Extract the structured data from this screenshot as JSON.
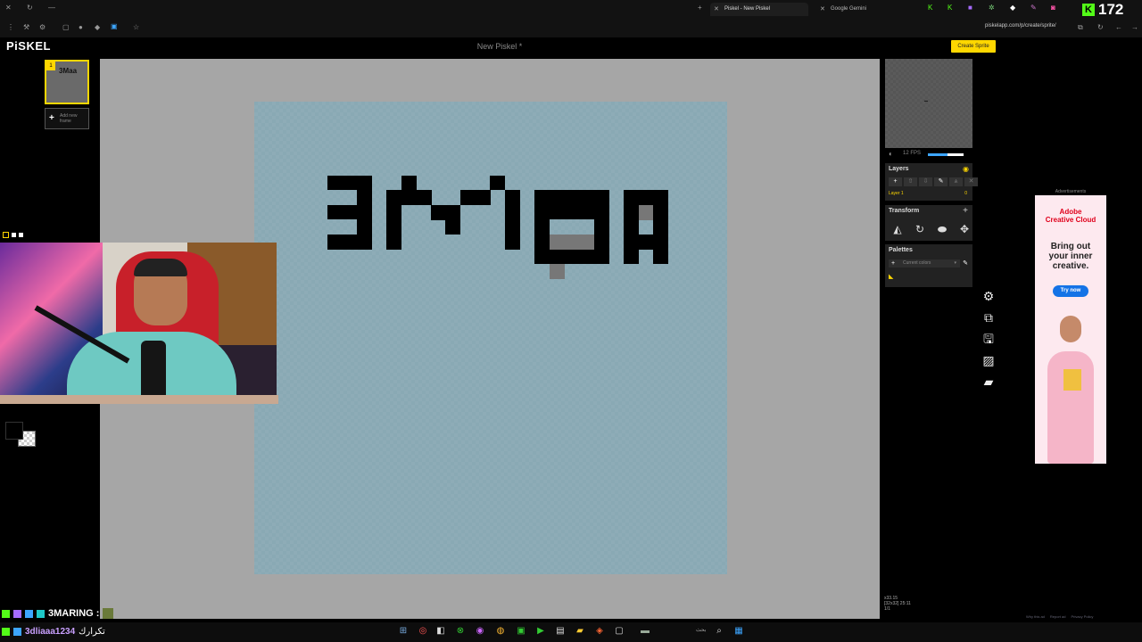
{
  "browser": {
    "tabs": [
      {
        "label": "Piskel - New Piskel",
        "active": true
      },
      {
        "label": "Google Gemini",
        "active": false
      }
    ],
    "url": "piskelapp.com/p/create/sprite/"
  },
  "stream_counter": {
    "badge": "K",
    "value": "172"
  },
  "app": {
    "logo": "PiSKEL",
    "title": "New Piskel *",
    "create_sprite": "Create Sprite"
  },
  "frames": {
    "frame_number": "1",
    "frame_thumb": "3Maa",
    "add_frame": "Add new frame"
  },
  "status": {
    "cursor": "x33.15",
    "size": "[32x32] 25:11",
    "frame_index": "1/1"
  },
  "preview": {
    "fps_label": "12 FPS",
    "fps_fraction": 0.55
  },
  "layers": {
    "title": "Layers",
    "layer_name": "Layer 1",
    "opacity": "0"
  },
  "transform": {
    "title": "Transform"
  },
  "palettes": {
    "title": "Palettes",
    "current": "Current colors"
  },
  "ad": {
    "label": "Advertisements",
    "brand1": "Adobe",
    "brand2": "Creative Cloud",
    "headline": "Bring out your inner creative.",
    "cta": "Try now",
    "footer": [
      "Why this ad",
      "Report ad",
      "Privacy Policy"
    ]
  },
  "chat": {
    "line1_name": "3MARING :",
    "line2_user": "3dliaaa1234",
    "line2_msg": "تكرارك"
  },
  "taskbar": {
    "search": "بحث"
  },
  "colors": {
    "accent": "#ffd700",
    "canvas_bg": "#89a9b4",
    "stage_bg": "#a6a6a6",
    "primary": "#000000"
  }
}
